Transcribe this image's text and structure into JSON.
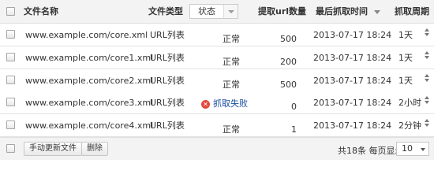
{
  "table": {
    "headers": {
      "name": "文件名称",
      "type": "文件类型",
      "status": "状态",
      "count": "提取url数量",
      "time": "最后抓取时间",
      "cycle": "抓取周期"
    },
    "rows": [
      {
        "name": "www.example.com/core.xml",
        "type": "URL列表",
        "status": "正常",
        "status_kind": "ok",
        "count": "500",
        "time": "2013-07-17 18:24",
        "cycle": "1天"
      },
      {
        "name": "www.example.com/core1.xml",
        "type": "URL列表",
        "status": "正常",
        "status_kind": "ok",
        "count": "200",
        "time": "2013-07-17 18:24",
        "cycle": "1天"
      },
      {
        "name": "www.example.com/core2.xml",
        "type": "URL列表",
        "status": "正常",
        "status_kind": "ok",
        "count": "500",
        "time": "2013-07-17 18:24",
        "cycle": "1天"
      },
      {
        "name": "www.example.com/core3.xml",
        "type": "URL列表",
        "status": "抓取失败",
        "status_kind": "fail",
        "count": "0",
        "time": "2013-07-17 18:24",
        "cycle": "2小时"
      },
      {
        "name": "www.example.com/core4.xml",
        "type": "URL列表",
        "status": "正常",
        "status_kind": "ok",
        "count": "1",
        "time": "2013-07-17 18:24",
        "cycle": "2分钟"
      }
    ]
  },
  "footer": {
    "update_button": "手动更新文件",
    "delete_button": "删除",
    "pager_info": "共18条 每页显示:",
    "page_size": "10"
  },
  "colors": {
    "fail_icon": "#e04a3f",
    "fail_text": "#1a4fa0",
    "header_bg": "#f3f3f3"
  }
}
